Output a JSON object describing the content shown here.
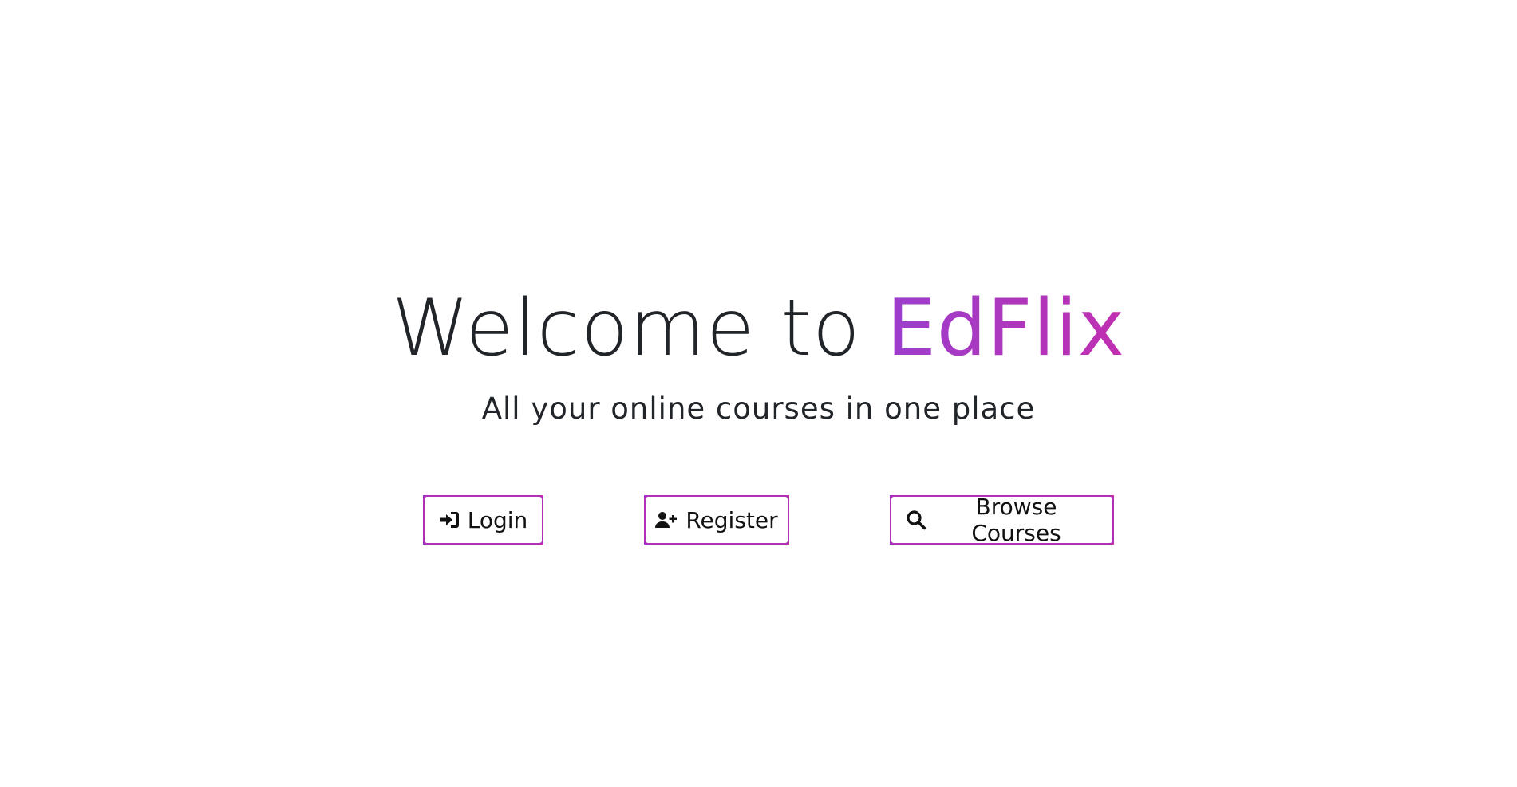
{
  "hero": {
    "title_prefix": "Welcome to ",
    "title_brand": "EdFlix",
    "subtitle": "All your online courses in one place"
  },
  "actions": {
    "login_label": "Login",
    "register_label": "Register",
    "browse_label": "Browse Courses"
  },
  "icons": {
    "login": "sign-in-icon",
    "register": "user-plus-icon",
    "browse": "search-icon"
  },
  "colors": {
    "brand_gradient_start": "#9b3fcc",
    "brand_gradient_end": "#c02fb0",
    "button_border": "#b030b8",
    "text": "#212529",
    "background": "#ffffff"
  }
}
